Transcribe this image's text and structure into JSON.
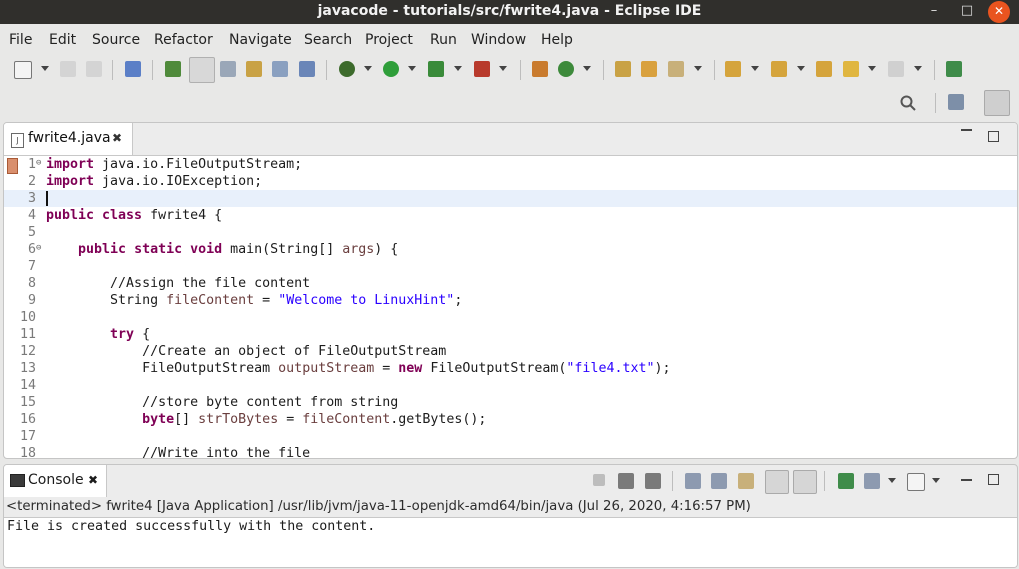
{
  "window": {
    "title": "javacode - tutorials/src/fwrite4.java - Eclipse IDE",
    "minimize": "–",
    "maximize": "□",
    "close": "✕"
  },
  "menu": [
    "File",
    "Edit",
    "Source",
    "Refactor",
    "Navigate",
    "Search",
    "Project",
    "Run",
    "Window",
    "Help"
  ],
  "editor": {
    "tab_label": "fwrite4.java",
    "tab_close": "✖",
    "file_icon_glyph": "J",
    "lines": [
      {
        "num": "1",
        "text": "import java.io.FileOutputStream;"
      },
      {
        "num": "2",
        "text": "import java.io.IOException;"
      },
      {
        "num": "3",
        "text": ""
      },
      {
        "num": "4",
        "text": "public class fwrite4 {"
      },
      {
        "num": "5",
        "text": ""
      },
      {
        "num": "6",
        "text": "    public static void main(String[] args) {"
      },
      {
        "num": "7",
        "text": ""
      },
      {
        "num": "8",
        "text": "        //Assign the file content"
      },
      {
        "num": "9",
        "text": "        String fileContent = \"Welcome to LinuxHint\";"
      },
      {
        "num": "10",
        "text": ""
      },
      {
        "num": "11",
        "text": "        try {"
      },
      {
        "num": "12",
        "text": "            //Create an object of FileOutputStream"
      },
      {
        "num": "13",
        "text": "            FileOutputStream outputStream = new FileOutputStream(\"file4.txt\");"
      },
      {
        "num": "14",
        "text": ""
      },
      {
        "num": "15",
        "text": "            //store byte content from string"
      },
      {
        "num": "16",
        "text": "            byte[] strToBytes = fileContent.getBytes();"
      },
      {
        "num": "17",
        "text": ""
      },
      {
        "num": "18",
        "text": "            //Write into the file"
      }
    ]
  },
  "console": {
    "tab_label": "Console",
    "tab_close": "✖",
    "terminated": "<terminated> fwrite4 [Java Application] /usr/lib/jvm/java-11-openjdk-amd64/bin/java (Jul 26, 2020, 4:16:57 PM)",
    "output": "File is created successfully with the content."
  },
  "toolbar": {
    "icons": [
      "new-icon",
      "save-icon",
      "save-all-icon",
      "skip-breakpoints-icon",
      "new-java-package-icon",
      "toggle-mark-occurrences-icon",
      "block-selection-icon",
      "show-whitespace-icon",
      "debug-icon",
      "run-icon",
      "coverage-icon",
      "external-tools-icon",
      "new-java-project-icon",
      "refresh-icon",
      "open-type-icon",
      "open-task-icon",
      "search-task-icon",
      "next-annotation-icon",
      "previous-annotation-icon",
      "last-edit-icon",
      "back-icon",
      "forward-icon",
      "pin-editor-icon",
      "search-icon",
      "open-perspective-icon",
      "java-perspective-icon"
    ]
  },
  "colors": {
    "titlebar": "#302f2c",
    "close_button": "#e9541f",
    "keyword": "#7f0055",
    "comment": "#3f7f5f",
    "string": "#2a00ff",
    "variable": "#6a3e3e",
    "current_line": "#e8f0fb"
  }
}
